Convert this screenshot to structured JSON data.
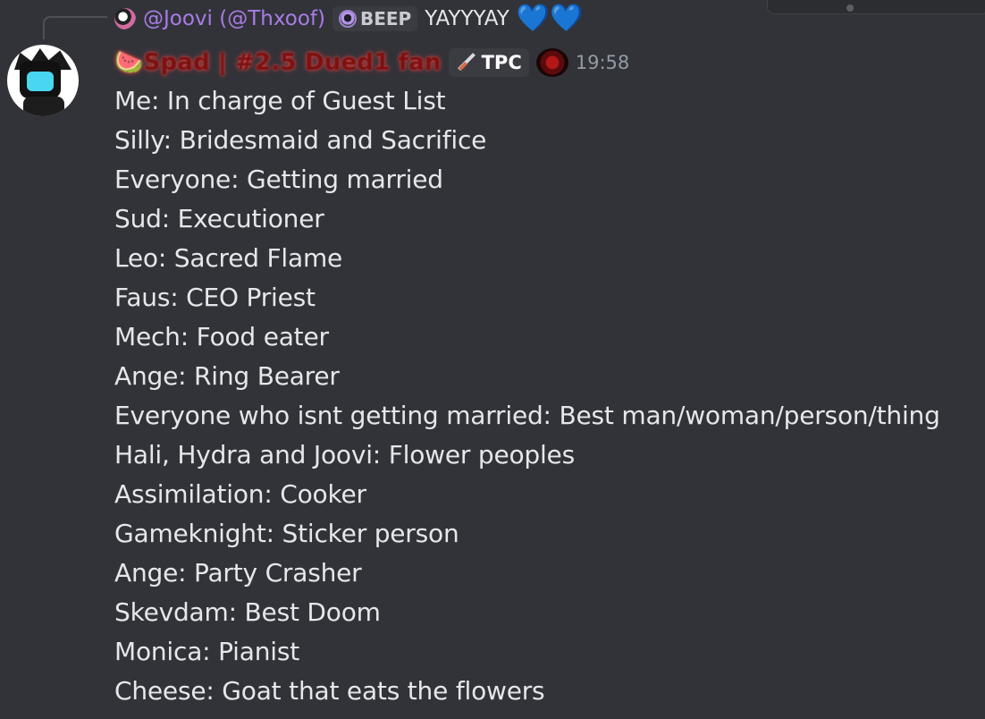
{
  "reply": {
    "user": "@Joovi (@Thxoof)",
    "badge": "BEEP",
    "text": "YAYYYAY",
    "hearts": [
      "💙",
      "💙"
    ]
  },
  "message": {
    "author": "🍉Spad | #2.5 Dued1 fan",
    "tag": "TPC",
    "timestamp": "19:58",
    "lines": [
      "Me: In charge of Guest List",
      "Silly: Bridesmaid and Sacrifice",
      "Everyone: Getting married",
      "Sud: Executioner",
      "Leo: Sacred Flame",
      "Faus: CEO Priest",
      "Mech: Food eater",
      "Ange: Ring Bearer",
      "Everyone who isnt getting married: Best man/woman/person/thing",
      "Hali, Hydra and Joovi: Flower peoples",
      "Assimilation: Cooker",
      "Gameknight: Sticker person",
      "Ange: Party Crasher",
      "Skevdam: Best Doom",
      "Monica: Pianist",
      "Cheese: Goat that eats the flowers"
    ]
  },
  "colors": {
    "background": "#323339",
    "reply_user": "#a97ce6",
    "username_glow": "#e24646",
    "heart": "#6fa8ee",
    "timestamp": "#949ba4"
  },
  "icons": [
    "reply-avatar-icon",
    "beep-badge-icon",
    "heart-icon",
    "user-avatar",
    "watermelon-icon",
    "sword-icon",
    "spider-icon"
  ]
}
